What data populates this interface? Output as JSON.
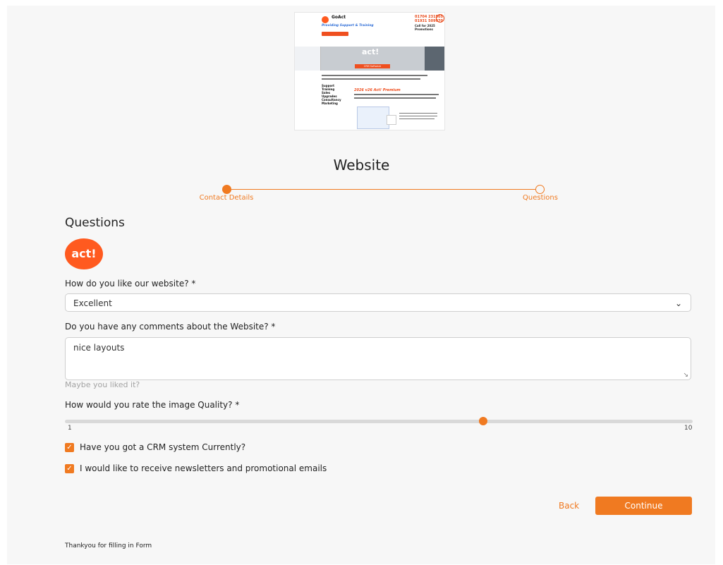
{
  "banner": {
    "brand": "GoAct",
    "brand_sub": "Consultants",
    "tagline": "Providing Support & Training",
    "phone1": "01704 231505",
    "phone2": "01931 509970",
    "call": "Call for 2025 Promotions",
    "badge": "act!",
    "crm": "CRM Software",
    "list": [
      "Support",
      "Training",
      "Sales",
      "Upgrades",
      "Consultancy",
      "Marketing"
    ],
    "premium": "2026 v26 Act! Premium"
  },
  "page": {
    "title": "Website",
    "steps": [
      "Contact Details",
      "Questions"
    ],
    "section_title": "Questions",
    "logo_text": "act!"
  },
  "form": {
    "q1_label": "How do you like our website? *",
    "q1_value": "Excellent",
    "q2_label": "Do you have any comments about the Website? *",
    "q2_value": "nice layouts",
    "q2_hint": "Maybe you liked it?",
    "q3_label": "How would you rate the image Quality? *",
    "slider_min": "1",
    "slider_max": "10",
    "slider_value": 7,
    "cb1_label": "Have you got a CRM system Currently?",
    "cb1_checked": true,
    "cb2_label": "I would like to receive newsletters and promotional emails",
    "cb2_checked": true
  },
  "actions": {
    "back": "Back",
    "continue": "Continue"
  },
  "footer": {
    "text": "Thankyou for filling in Form"
  },
  "colors": {
    "accent": "#f07a21",
    "logo": "#ff5a1f"
  }
}
